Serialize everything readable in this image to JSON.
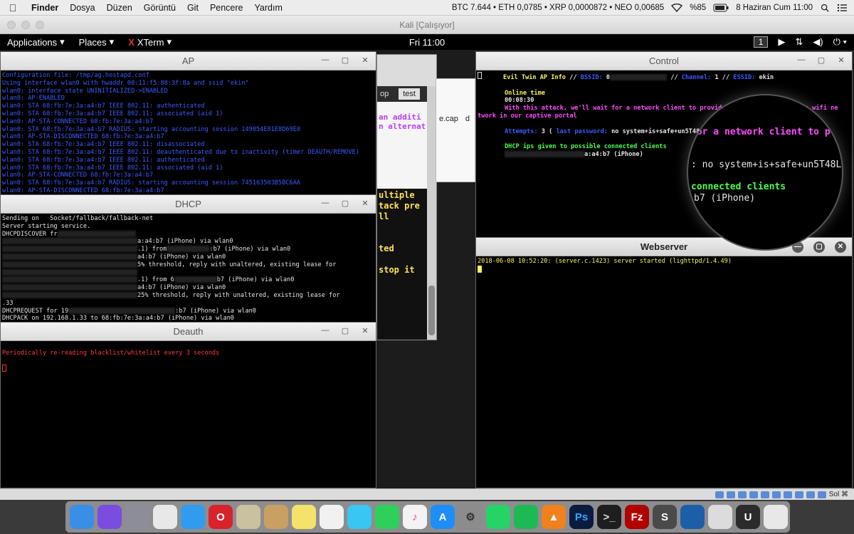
{
  "mac_menubar": {
    "app": "Finder",
    "items": [
      "Dosya",
      "Düzen",
      "Görüntü",
      "Git",
      "Pencere",
      "Yardım"
    ],
    "ticker": "BTC 7.644 • ETH 0,0785 • XRP 0,0000872 • NEO 0,00685",
    "battery": "%85",
    "datetime": "8 Haziran Cum  11:00"
  },
  "vbox": {
    "title": "Kali [Çalışıyor]",
    "status_host_key": "Sol ⌘"
  },
  "kali_bar": {
    "applications": "Applications",
    "places": "Places",
    "xterm": "XTerm",
    "clock": "Fri 11:00",
    "workspace": "1"
  },
  "windows": {
    "ap": {
      "title": "AP",
      "lines": [
        "Configuration file: /tmp/ag.hostapd.conf",
        "Using interface wlan0 with hwaddr 00:11:f5:88:3f:8a and ssid \"ekin\"",
        "wlan0: interface state UNINITIALIZED->ENABLED",
        "wlan0: AP-ENABLED",
        "wlan0: STA 68:fb:7e:3a:a4:b7 IEEE 802.11: authenticated",
        "wlan0: STA 68:fb:7e:3a:a4:b7 IEEE 802.11: associated (aid 1)",
        "wlan0: AP-STA-CONNECTED 68:fb:7e:3a:a4:b7",
        "wlan0: STA 68:fb:7e:3a:a4:b7 RADIUS: starting accounting session 149054E81E8D69E0",
        "wlan0: AP-STA-DISCONNECTED 68:fb:7e:3a:a4:b7",
        "wlan0: STA 68:fb:7e:3a:a4:b7 IEEE 802.11: disassociated",
        "wlan0: STA 68:fb:7e:3a:a4:b7 IEEE 802.11: deauthenticated due to inactivity (timer DEAUTH/REMOVE)",
        "wlan0: STA 68:fb:7e:3a:a4:b7 IEEE 802.11: authenticated",
        "wlan0: STA 68:fb:7e:3a:a4:b7 IEEE 802.11: associated (aid 1)",
        "wlan0: AP-STA-CONNECTED 68:fb:7e:3a:a4:b7",
        "wlan0: STA 68:fb:7e:3a:a4:b7 RADIUS: starting accounting session 745163503B5BC6AA",
        "wlan0: AP-STA-DISCONNECTED 68:fb:7e:3a:a4:b7"
      ]
    },
    "dhcp": {
      "title": "DHCP",
      "line1": "Sending on   Socket/fallback/fallback-net",
      "line2": "Server starting service.",
      "line3": "DHCPDISCOVER fr",
      "line4": "a:a4:b7 (iPhone) via wlan0",
      "line5": ".1) from",
      "line5b": ":b7 (iPhone) via wlan0",
      "line6": "a4:b7 (iPhone) via wlan0",
      "line7": "5% threshold, reply with unaltered, existing lease for",
      "line8": ".1) from 6",
      "line8b": "b7 (iPhone) via wlan0",
      "line9": "a4:b7 (iPhone) via wlan0",
      "line10": "25% threshold, reply with unaltered, existing lease for",
      "line11": ".33",
      "line12": "DHCPREQUEST for 19",
      "line12b": ":b7 (iPhone) via wlan0",
      "line13": "DHCPACK on 192.168.1.33 to 68:fb:7e:3a:a4:b7 (iPhone) via wlan0"
    },
    "deauth": {
      "title": "Deauth",
      "line1": "Periodically re-reading blacklist/whitelist every 3 seconds"
    },
    "control": {
      "title": "Control",
      "header_name": "Evil Twin AP Info",
      "bssid_label": "BSSID:",
      "bssid_value": "0",
      "channel_label": "Channel:",
      "channel_value": "1",
      "essid_label": "ESSID:",
      "essid_value": "ekin",
      "online_label": "Online time",
      "online_value": "00:08:30",
      "message_a": "With this attack, we'll wait for a network client to provide u",
      "message_b": "for the wifi ne",
      "message_c": "twork in our captive portal",
      "attempts_label": "Attempts:",
      "attempts_value": "3",
      "last_password_label": "last password:",
      "last_password_value": "no system+is+safe+un5T48L3",
      "dhcp_label": "DHCP ips given to possible connected clients",
      "client_value": "a:a4:b7 (iPhone)"
    },
    "webserver": {
      "title": "Webserver",
      "line1": "2018-06-08 10:52:20: (server.c.1423) server started (lighttpd/1.4.49)"
    },
    "background": {
      "tab1": "op",
      "tab2": "test",
      "file_text": "e.cap",
      "file_text2": "d",
      "line_a": "an additi",
      "line_b": "n alternat",
      "editor_lines": [
        "ultiple",
        "tack pre",
        "ll",
        "",
        "",
        "ted",
        "",
        "stop it"
      ]
    }
  },
  "magnifier": {
    "line1": "for a network client to p",
    "line2": ": no system+is+safe+un5T48L3",
    "line3": "connected clients",
    "line4": "b7 (iPhone)"
  },
  "dock": {
    "apps": [
      "finder-icon",
      "siri-icon",
      "launchpad-icon",
      "chrome-icon",
      "safari-icon",
      "opera-icon",
      "mail-icon",
      "contacts-icon",
      "notes-icon",
      "photos-icon",
      "messages-icon",
      "facetime-icon",
      "itunes-icon",
      "appstore-icon",
      "system-preferences-icon",
      "whatsapp-icon",
      "spotify-icon",
      "vlc-icon",
      "photoshop-icon",
      "terminal-icon",
      "filezilla-icon",
      "sublime-icon",
      "virtualbox-icon",
      "activity-icon",
      "unity-icon",
      "trash-icon"
    ],
    "labels": [
      "",
      "",
      "",
      "",
      "",
      "O",
      "",
      "",
      "",
      "",
      "",
      "",
      "♪",
      "A",
      "⚙",
      "",
      "",
      "▲",
      "Ps",
      ">_",
      "Fz",
      "S",
      "",
      "",
      "U",
      ""
    ]
  },
  "colors": {
    "term_blue": "#3b5cff",
    "term_red": "#ff3b3b",
    "term_yellow": "#fff45a",
    "term_magenta": "#ff4cff",
    "term_green": "#4cff4c"
  }
}
